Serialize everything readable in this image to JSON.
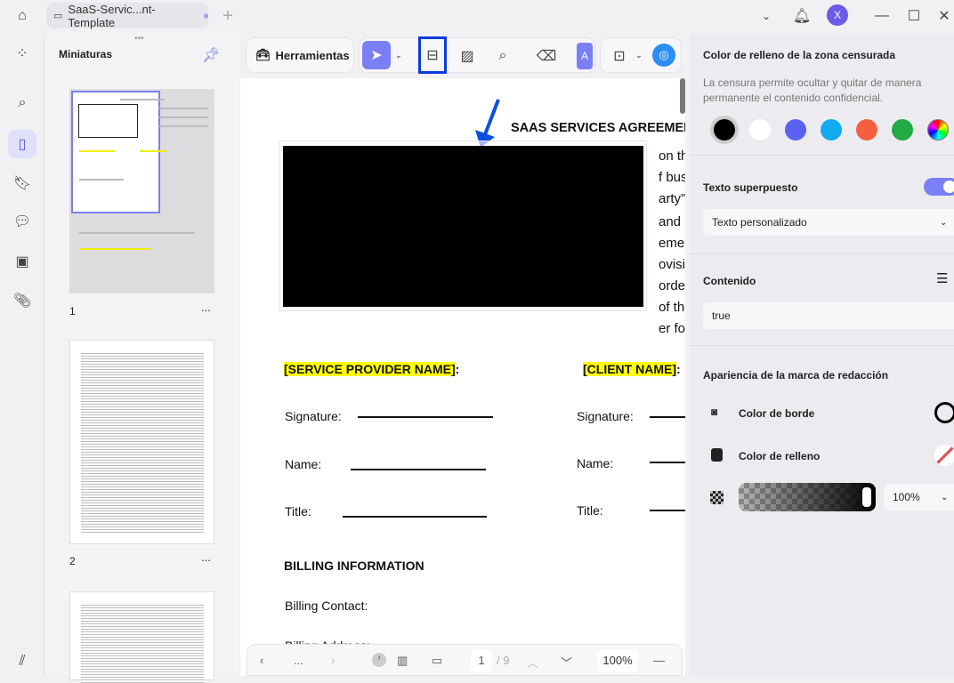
{
  "tab": {
    "title": "SaaS-Servic...nt-Template"
  },
  "window": {
    "avatar": "X"
  },
  "sidebar": {
    "title": "Miniaturas",
    "pages": [
      {
        "num": "1"
      },
      {
        "num": "2"
      }
    ],
    "more": "..."
  },
  "toolbar": {
    "tools_label": "Herramientas",
    "ai_letter": "A"
  },
  "document": {
    "title": "SAAS SERVICES AGREEMENT",
    "right_fragments": [
      "on this |",
      "f busine",
      "arty” or",
      "and Co",
      "ement co",
      "ovisions c",
      "order fo",
      "of the P",
      "er form"
    ],
    "provider": "[SERVICE PROVIDER NAME]",
    "client": "[CLIENT NAME]",
    "colon": ":",
    "signature": "Signature:",
    "name": "Name:",
    "title_field": "Title:",
    "billing_heading": "BILLING INFORMATION",
    "billing_contact": "Billing Contact:",
    "billing_address": "Billing Address:"
  },
  "bottom": {
    "page_current": "1",
    "page_total": "/ 9",
    "zoom": "100%",
    "more": "..."
  },
  "panel": {
    "fill_title": "Color de relleno de la zona censurada",
    "fill_desc": "La censura permite ocultar y quitar de manera permanente el contenido confidencial.",
    "colors": [
      "#000000",
      "#ffffff",
      "#5b62f0",
      "#12aaf0",
      "#f4603f",
      "#22aa44"
    ],
    "overlay_title": "Texto superpuesto",
    "overlay_on": true,
    "overlay_select": "Texto personalizado",
    "content_title": "Contenido",
    "content_value": "true",
    "appearance_title": "Apariencia de la marca de redacción",
    "border_color": "Color de borde",
    "fill_color": "Color de relleno",
    "opacity": "100%",
    "accent": "#7b7ff5"
  }
}
